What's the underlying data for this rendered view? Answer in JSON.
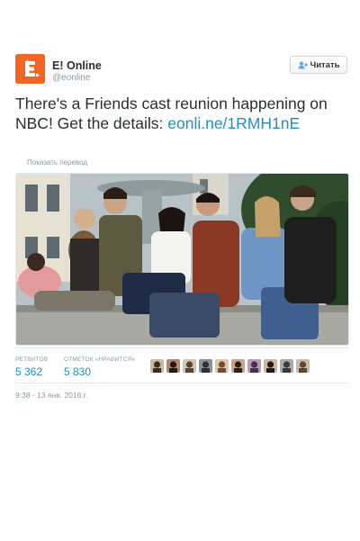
{
  "tweet": {
    "account": {
      "name": "E! Online",
      "handle": "@eonline",
      "avatar_icon": "e-online-logo-icon",
      "avatar_color": "#f26522"
    },
    "follow_button": {
      "label": "Читать",
      "icon": "follow-user-icon"
    },
    "text": {
      "before_link": "There's a Friends cast reunion happening on NBC! Get the details: ",
      "link": "eonli.ne/1RMH1nE",
      "link_color": "#1e8ec7"
    },
    "translate_label": "Показать перевод",
    "photo_icon": "friends-cast-photo",
    "stats": {
      "retweets_label": "РЕТВИТОВ",
      "retweets_value": "5 362",
      "likes_label": "ОТМЕТОК «НРАВИТСЯ»",
      "likes_value": "5 830"
    },
    "likers": [
      "liker-avatar-1",
      "liker-avatar-2",
      "liker-avatar-3",
      "liker-avatar-4",
      "liker-avatar-5",
      "liker-avatar-6",
      "liker-avatar-7",
      "liker-avatar-8",
      "liker-avatar-9",
      "liker-avatar-10"
    ],
    "timestamp": "9:38 - 13 янв. 2016 г."
  }
}
